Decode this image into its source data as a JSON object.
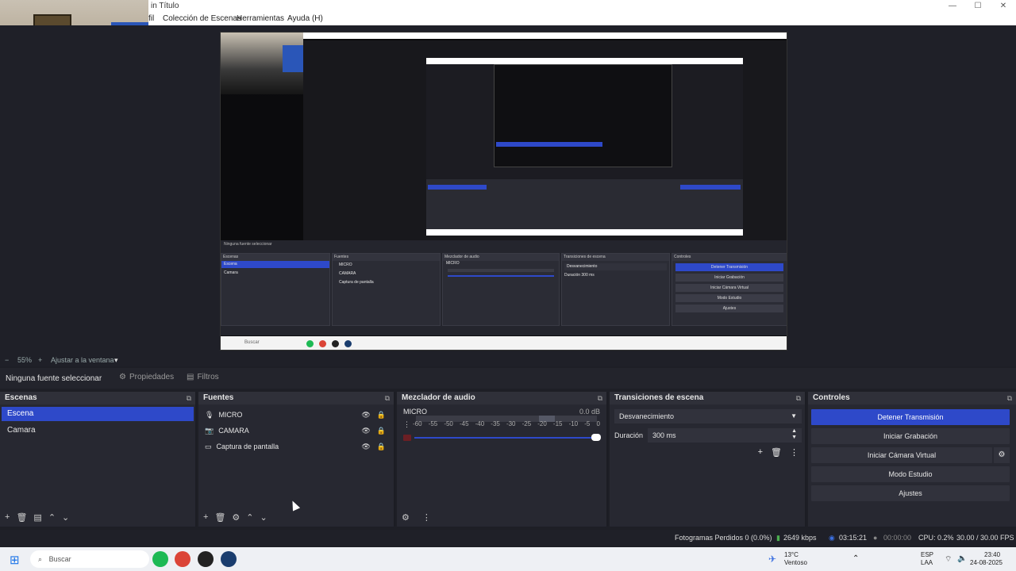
{
  "titlebar": {
    "title": "in Título",
    "minimize": "—",
    "maximize": "☐",
    "close": "✕"
  },
  "menu": {
    "m0": "fil",
    "m1": "Colección de Escenas",
    "m2": "Herramientas",
    "m3": "Ayuda (H)"
  },
  "zoom": {
    "minus": "−",
    "percent": "55%",
    "plus": "+",
    "fit": "Ajustar a la ventana",
    "arrow": "▾"
  },
  "source_toolbar": {
    "no_source": "Ninguna fuente seleccionar",
    "properties": "Propiedades",
    "filters": "Filtros"
  },
  "scenes": {
    "title": "Escenas",
    "items": [
      {
        "label": "Escena"
      },
      {
        "label": "Camara"
      }
    ]
  },
  "sources": {
    "title": "Fuentes",
    "items": [
      {
        "label": "MICRO",
        "icon": "mic-icon"
      },
      {
        "label": "CAMARA",
        "icon": "camera-icon"
      },
      {
        "label": "Captura de pantalla",
        "icon": "monitor-icon"
      }
    ]
  },
  "mixer": {
    "title": "Mezclador de audio",
    "channel": "MICRO",
    "db": "0.0 dB",
    "scale": [
      "-60",
      "-55",
      "-50",
      "-45",
      "-40",
      "-35",
      "-30",
      "-25",
      "-20",
      "-15",
      "-10",
      "-5",
      "0"
    ],
    "volume_fraction": 1.0
  },
  "transitions": {
    "title": "Transiciones de escena",
    "selected": "Desvanecimiento",
    "duration_label": "Duración",
    "duration_value": "300 ms"
  },
  "controls": {
    "title": "Controles",
    "stop_stream": "Detener Transmisión",
    "start_record": "Iniciar Grabación",
    "virtual_cam": "Iniciar Cámara Virtual",
    "studio_mode": "Modo Estudio",
    "settings": "Ajustes"
  },
  "status": {
    "dropped": "Fotogramas Perdidos 0 (0.0%)",
    "bitrate": "2649 kbps",
    "stream_time": "03:15:21",
    "rec_time": "00:00:00",
    "cpu": "CPU: 0.2%",
    "fps": "30.00 / 30.00 FPS"
  },
  "taskbar": {
    "search": "Buscar",
    "weather_temp": "13°C",
    "weather_desc": "Ventoso",
    "lang": "ESP",
    "lang2": "LAA",
    "time": "23:40",
    "date": "24-08-2025"
  },
  "nested": {
    "no_source": "Ninguna fuente seleccionar",
    "escenas": "Escenas",
    "fuentes": "Fuentes",
    "mezclador": "Mezclador de audio",
    "transiciones": "Transiciones de escena",
    "controles": "Controles",
    "escena": "Escena",
    "camara": "Camara",
    "micro": "MICRO",
    "camara_src": "CAMARA",
    "captura": "Captura de pantalla",
    "desvanecimiento": "Desvanecimiento",
    "duracion": "Duración",
    "duracion_val": "300 ms",
    "btn1": "Detener Transmisión",
    "btn2": "Iniciar Grabación",
    "btn3": "Iniciar Cámara Virtual",
    "btn4": "Modo Estudio",
    "btn5": "Ajustes",
    "search": "Buscar"
  },
  "colors": {
    "accent": "#2e49c9",
    "panel": "#272831",
    "background": "#1e1f26"
  }
}
